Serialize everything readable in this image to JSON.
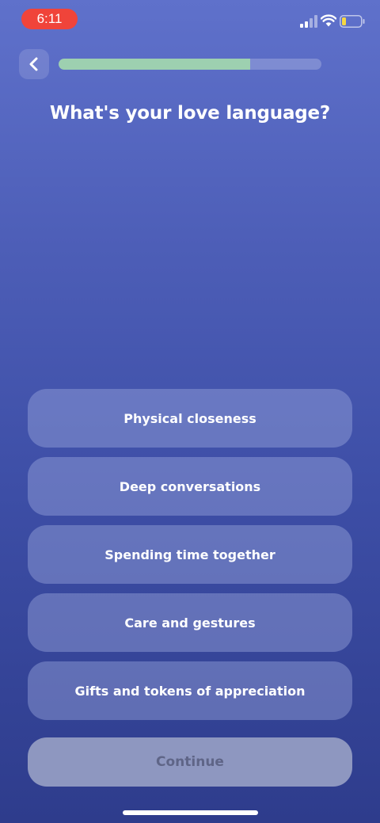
{
  "status_bar": {
    "time": "6:11",
    "time_pill_color": "#f0443a",
    "icons": [
      "signal-icon",
      "wifi-icon",
      "battery-icon"
    ],
    "battery_level": 0.2
  },
  "header": {
    "back_icon": "chevron-left-icon",
    "progress": 0.73,
    "progress_color": "#9dd0b0"
  },
  "question": {
    "title": "What's your love language?"
  },
  "options": [
    {
      "label": "Physical closeness"
    },
    {
      "label": "Deep conversations"
    },
    {
      "label": "Spending time together"
    },
    {
      "label": "Care and gestures"
    },
    {
      "label": "Gifts and tokens of appreciation"
    }
  ],
  "footer": {
    "continue_label": "Continue"
  }
}
